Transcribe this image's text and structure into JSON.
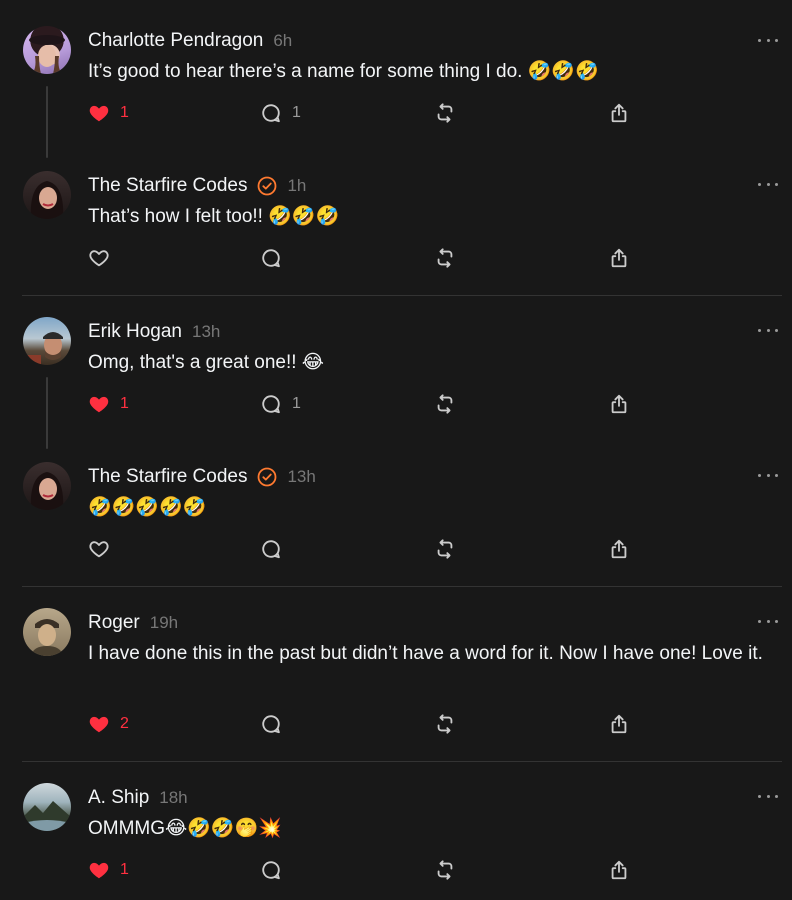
{
  "colors": {
    "background": "#181818",
    "text": "#f3f5f7",
    "muted": "#777777",
    "like": "#ff3040",
    "verified": "#ff7a30"
  },
  "posts": [
    {
      "name": "Charlotte Pendragon",
      "verified": false,
      "time": "6h",
      "text": "It’s good to hear there’s a name for some thing I do. 🤣🤣🤣",
      "liked": true,
      "likes": "1",
      "replies": "1",
      "avatar": "avatar-woman-hat"
    },
    {
      "name": "The Starfire Codes",
      "verified": true,
      "time": "1h",
      "text": "That’s how I felt too!! 🤣🤣🤣",
      "liked": false,
      "likes": "",
      "replies": "",
      "avatar": "avatar-woman-dark-hair"
    },
    {
      "name": "Erik Hogan",
      "verified": false,
      "time": "13h",
      "text": "Omg, that's a great one!! 😂",
      "liked": true,
      "likes": "1",
      "replies": "1",
      "avatar": "avatar-man-cap"
    },
    {
      "name": "The Starfire Codes",
      "verified": true,
      "time": "13h",
      "text": "🤣🤣🤣🤣🤣",
      "liked": false,
      "likes": "",
      "replies": "",
      "avatar": "avatar-woman-dark-hair"
    },
    {
      "name": "Roger",
      "verified": false,
      "time": "19h",
      "text": "I have done this in the past but didn’t have a word for it. Now I have one! Love it.",
      "liked": true,
      "likes": "2",
      "replies": "",
      "avatar": "avatar-man-vintage"
    },
    {
      "name": "A. Ship",
      "verified": false,
      "time": "18h",
      "text": "OMMMG😂🤣🤣🤭💥",
      "liked": true,
      "likes": "1",
      "replies": "",
      "avatar": "avatar-landscape"
    }
  ]
}
